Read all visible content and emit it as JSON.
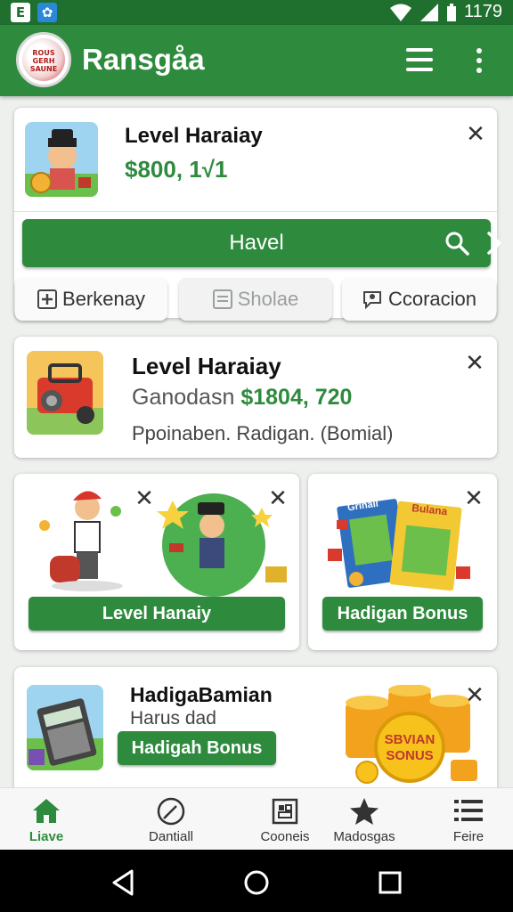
{
  "status_bar": {
    "left_icons": [
      {
        "icon": "notification-app-icon",
        "glyph": "E"
      },
      {
        "icon": "notification-bird-icon",
        "glyph": "✿"
      }
    ],
    "time": "1179"
  },
  "app_bar": {
    "title": "Ransgåa",
    "logo_text": "ROUS GERH SAUNE"
  },
  "card1": {
    "title": "Level Haraiay",
    "value": "$800, 1√1"
  },
  "action_bar": {
    "label": "Havel"
  },
  "pills": [
    {
      "label": "Berkenay",
      "state": "active"
    },
    {
      "label": "Sholae",
      "state": "disabled"
    },
    {
      "label": "Ccoracion",
      "state": "active"
    }
  ],
  "card2": {
    "title": "Level Haraiay",
    "label": "Ganodasn",
    "amount": "$1804, 720",
    "subtitle": "Ppoinaben. Radigan. (Bomial)"
  },
  "card3": {
    "button_label": "Level Hanaiy"
  },
  "card4": {
    "button_label": "Hadigan Bonus",
    "book1_text": "Grinall",
    "book2_text": "Bulana"
  },
  "card5": {
    "title": "HadigaBamian",
    "subtitle": "Harus dad",
    "button_label": "Hadigah Bonus",
    "coin_text_1": "SBVIAN",
    "coin_text_2": "SONUS"
  },
  "bottom_nav": [
    {
      "label": "Liave",
      "icon": "home-icon",
      "active": true
    },
    {
      "label": "Dantiall",
      "icon": "edit-circle-icon",
      "active": false
    },
    {
      "label": "Cooneis",
      "icon": "grid-icon",
      "active": false
    },
    {
      "label": "Madosgas",
      "icon": "star-icon",
      "active": false
    },
    {
      "label": "Feire",
      "icon": "list-icon",
      "active": false
    }
  ],
  "colors": {
    "primary": "#2e8b3e",
    "status_bar": "#1f6f2e"
  }
}
